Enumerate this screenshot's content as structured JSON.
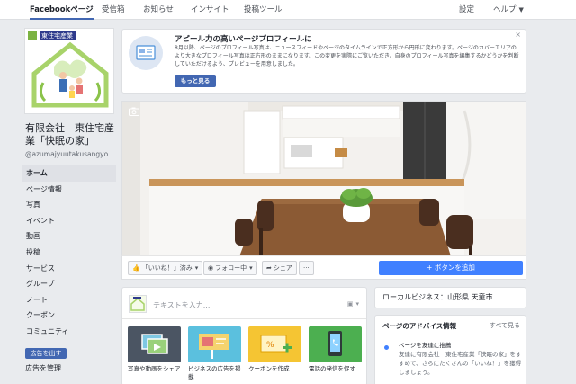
{
  "topnav": {
    "tabs": [
      {
        "label": "Facebookページ",
        "active": true
      },
      {
        "label": "受信箱",
        "active": false
      },
      {
        "label": "お知らせ",
        "active": false
      },
      {
        "label": "インサイト",
        "active": false
      },
      {
        "label": "投稿ツール",
        "active": false
      }
    ],
    "settings": "設定",
    "help": "ヘルプ"
  },
  "page": {
    "name": "有限会社　東住宅産業「快眠の家」",
    "handle": "@azumajyuutakusangyo",
    "logo_text": "東住宅産業"
  },
  "sidebar": {
    "items": [
      {
        "label": "ホーム",
        "active": true
      },
      {
        "label": "ページ情報"
      },
      {
        "label": "写真"
      },
      {
        "label": "イベント"
      },
      {
        "label": "動画"
      },
      {
        "label": "投稿"
      },
      {
        "label": "サービス"
      },
      {
        "label": "グループ"
      },
      {
        "label": "ノート"
      },
      {
        "label": "クーポン"
      },
      {
        "label": "コミュニティ"
      }
    ],
    "promote_button": "広告を出す",
    "manage_ads": "広告を管理"
  },
  "banner": {
    "title": "アピール力の高いページプロフィールに",
    "body": "8月以降、ページのプロフィール写真は、ニュースフィードやページのタイムラインで正方形から円形に変わります。ページのカバーエリアのより大きなプロフィール写真は正方形のままになります。この変更を実際にご覧いただき、自身のプロフィール写真を編集するかどうかを判断していただけるよう、プレビューを用意しました。",
    "button": "もっと見る",
    "close": "×"
  },
  "actions": {
    "like": "「いいね！」済み",
    "follow": "フォロー中",
    "share": "シェア",
    "more": "···",
    "add_button": "+ ボタンを追加"
  },
  "composer": {
    "placeholder": "テキストを入力...",
    "tiles": [
      {
        "label": "写真や動画をシェア",
        "color": "#4b5563"
      },
      {
        "label": "ビジネスの広告を掲載",
        "color": "#5bc0de"
      },
      {
        "label": "クーポンを作成",
        "color": "#f5c533"
      },
      {
        "label": "電話の発信を促す",
        "color": "#4caf50"
      }
    ]
  },
  "local_business": "ローカルビジネス：山形県 天童市",
  "advice": {
    "title": "ページのアドバイス情報",
    "see_all": "すべて見る",
    "item_title": "ページを友達に推薦",
    "item_body": "友達に有限会社　東住宅産業「快眠の家」をすすめて、さらにたくさんの「いいね！」を獲得しましょう。"
  }
}
